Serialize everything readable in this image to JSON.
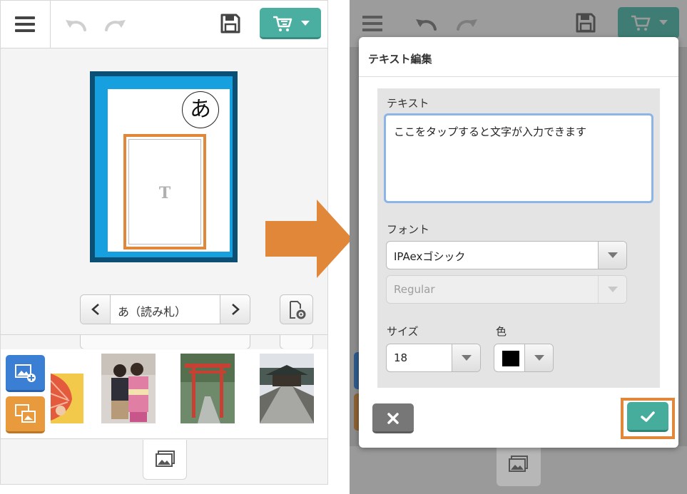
{
  "left_screen": {
    "card": {
      "kana": "あ",
      "text_placeholder": "T"
    },
    "pager": {
      "label": "あ（読み札）",
      "prev_icon": "chevron-left-icon",
      "next_icon": "chevron-right-icon"
    },
    "toolbar_icons": [
      "menu-icon",
      "undo-icon",
      "redo-icon",
      "save-icon",
      "cart-icon"
    ],
    "photo_tools": [
      "add-photo-icon",
      "swap-photo-icon"
    ],
    "bottom_tab_icon": "gallery-icon"
  },
  "text_dialog": {
    "title": "テキスト編集",
    "text_label": "テキスト",
    "text_value": "ここをタップすると文字が入力できます",
    "font_label": "フォント",
    "font_value": "IPAexゴシック",
    "weight_value": "Regular",
    "size_label": "サイズ",
    "size_value": "18",
    "color_label": "色",
    "color_value": "#000000",
    "cancel_icon": "close-icon",
    "confirm_icon": "check-icon"
  },
  "colors": {
    "accent_teal": "#4aaea0",
    "highlight_orange": "#e0873a",
    "card_navy": "#0b4f75",
    "card_blue": "#16a0e0",
    "add_photo_blue": "#3b7fd4",
    "swap_photo_orange": "#e99a3c"
  }
}
